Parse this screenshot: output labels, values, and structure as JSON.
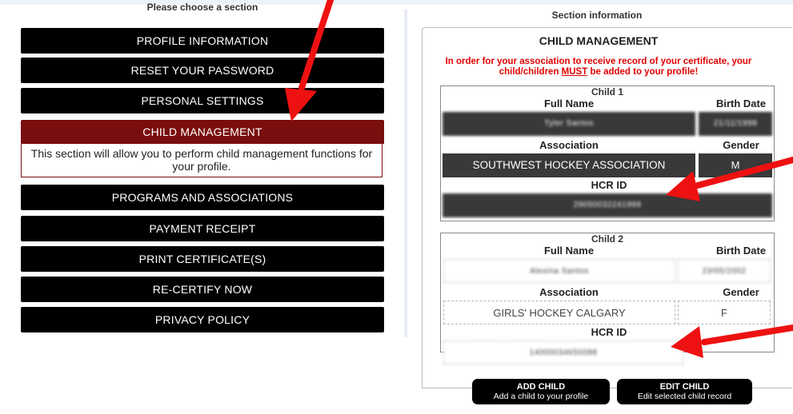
{
  "left": {
    "header": "Please choose a section",
    "nav": [
      {
        "label": "PROFILE INFORMATION"
      },
      {
        "label": "RESET YOUR PASSWORD"
      },
      {
        "label": "PERSONAL SETTINGS"
      },
      {
        "label": "CHILD MANAGEMENT"
      },
      {
        "label": "PROGRAMS AND ASSOCIATIONS"
      },
      {
        "label": "PAYMENT RECEIPT"
      },
      {
        "label": "PRINT CERTIFICATE(S)"
      },
      {
        "label": "RE-CERTIFY NOW"
      },
      {
        "label": "PRIVACY POLICY"
      }
    ],
    "active_description": "This section will allow you to perform child management functions for your profile."
  },
  "right": {
    "header": "Section information",
    "panel_title": "CHILD MANAGEMENT",
    "warning_before": "In order for your association to receive record of your certificate, your child/children ",
    "warning_must": "MUST",
    "warning_after": " be added to your profile!",
    "labels": {
      "full_name": "Full Name",
      "birth_date": "Birth Date",
      "association": "Association",
      "gender": "Gender",
      "hcr_id": "HCR ID"
    },
    "children": [
      {
        "heading": "Child 1",
        "full_name": "Tyler Santos",
        "birth_date": "21/11/1998",
        "association": "SOUTHWEST HOCKEY ASSOCIATION",
        "gender": "M",
        "hcr_id": "29050032241999"
      },
      {
        "heading": "Child 2",
        "full_name": "Alexina Santos",
        "birth_date": "23/05/2002",
        "association": "GIRLS' HOCKEY CALGARY",
        "gender": "F",
        "hcr_id": "14000034650088"
      }
    ],
    "buttons": {
      "add_title": "ADD CHILD",
      "add_sub": "Add a child to your profile",
      "edit_title": "EDIT CHILD",
      "edit_sub": "Edit selected child record"
    }
  },
  "colors": {
    "nav_bg": "#000000",
    "active_bg": "#7a0d0d",
    "warning": "#e00000",
    "arrow": "#ee1111",
    "selected_row": "#393939"
  },
  "icons": [
    "red-arrow-icon"
  ]
}
